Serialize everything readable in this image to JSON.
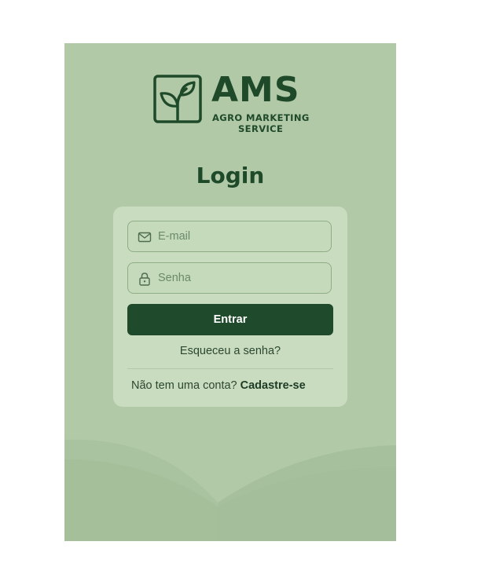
{
  "brand": {
    "name": "AMS",
    "tagline_line1": "AGRO MARKETING",
    "tagline_line2": "SERVICE",
    "logo_icon": "plant-sprout-icon"
  },
  "page": {
    "title": "Login"
  },
  "form": {
    "email": {
      "placeholder": "E-mail",
      "value": "",
      "icon": "mail-icon"
    },
    "password": {
      "placeholder": "Senha",
      "value": "",
      "icon": "lock-icon"
    },
    "submit_label": "Entrar",
    "forgot_label": "Esqueceu a senha?",
    "signup_prompt": "Não tem uma conta?",
    "signup_link": "Cadastre-se"
  },
  "colors": {
    "background": "#b1c9a7",
    "card": "#c9dcc0",
    "brand_dark_green": "#1e4a2a",
    "button": "#1f4a2c"
  }
}
